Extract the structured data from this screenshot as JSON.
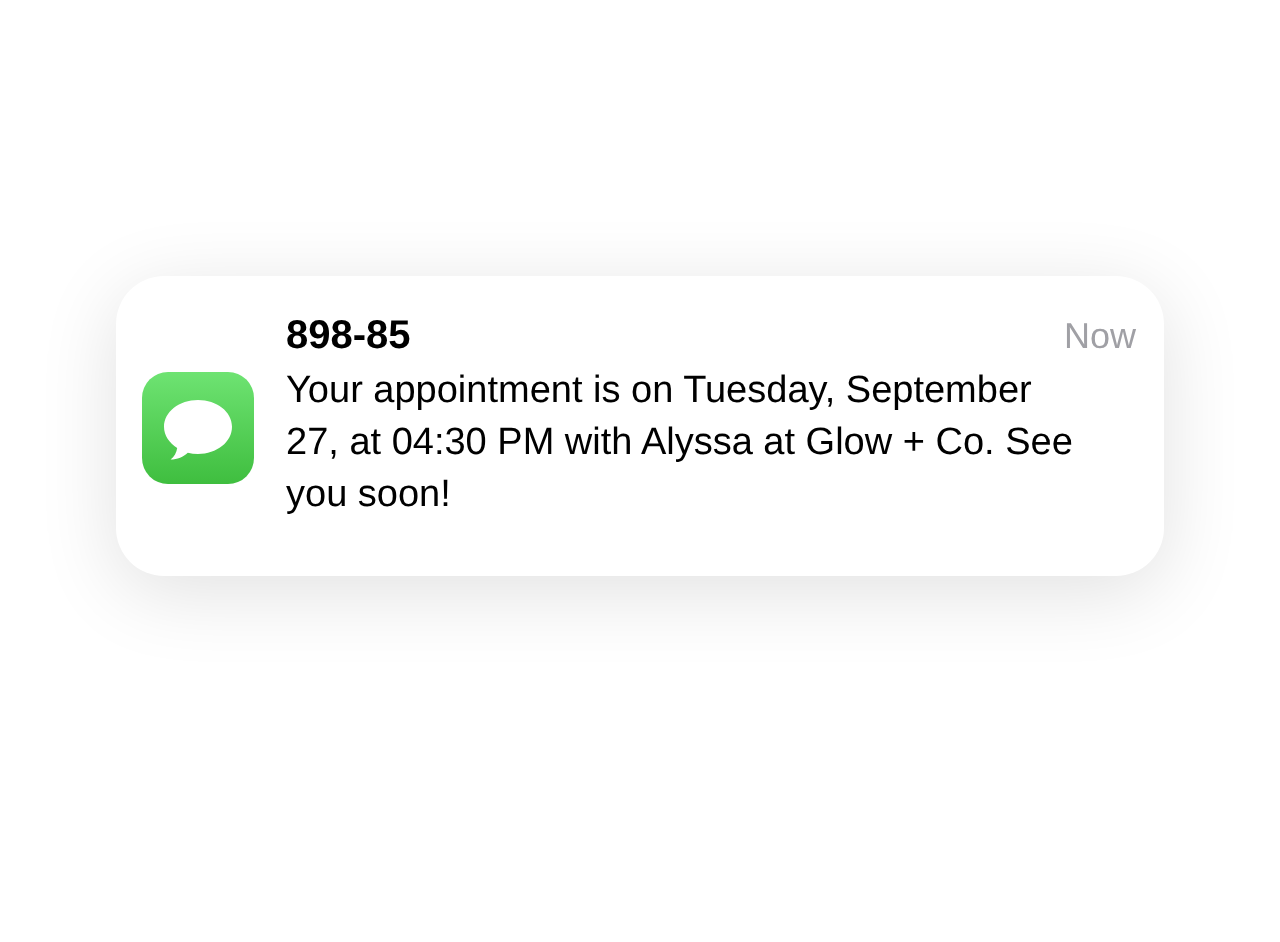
{
  "notification": {
    "sender": "898-85",
    "time": "Now",
    "message": "Your appointment is on Tuesday, September 27, at 04:30 PM with Alyssa at Glow + Co. See you soon!"
  }
}
